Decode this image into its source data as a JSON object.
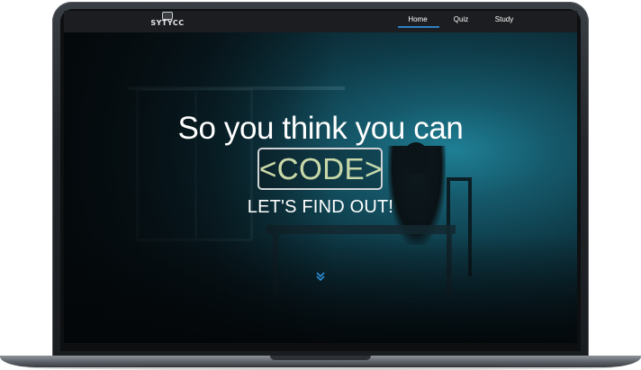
{
  "brand": {
    "logo_text": "SYTYCC",
    "logo_icon": "laptop-logo-icon"
  },
  "nav": {
    "items": [
      {
        "label": "Home",
        "active": true
      },
      {
        "label": "Quiz",
        "active": false
      },
      {
        "label": "Study",
        "active": false
      }
    ],
    "active_color": "#2f7fc4"
  },
  "hero": {
    "headline": "So you think you can",
    "code_open": "<",
    "code_word": "CODE",
    "code_close": ">",
    "subheadline": "LET'S FIND OUT!",
    "scroll_icon": "double-chevron-down-icon",
    "accent_color": "#1f7f95"
  }
}
